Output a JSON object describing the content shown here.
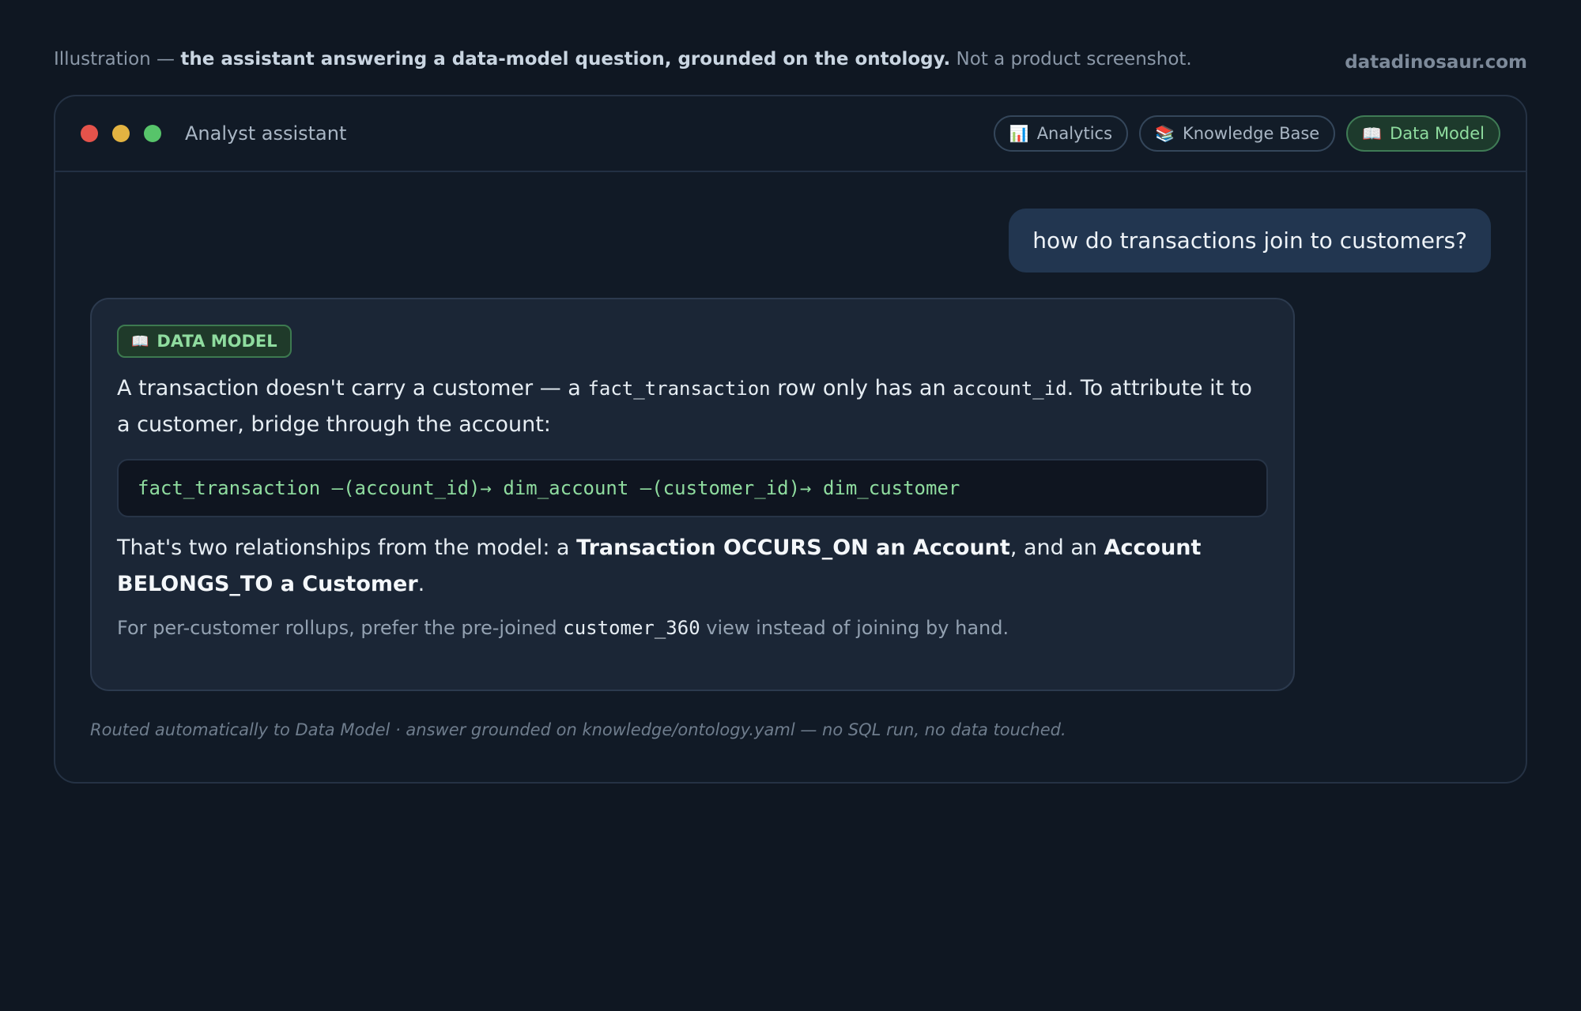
{
  "caption": {
    "prefix": "Illustration — ",
    "bold": "the assistant answering a data-model question, grounded on the ontology.",
    "suffix": " Not a product screenshot."
  },
  "brand": "datadinosaur.com",
  "window": {
    "title": "Analyst assistant",
    "tabs": [
      {
        "label": "Analytics",
        "icon": "bar-chart-icon"
      },
      {
        "label": "Knowledge Base",
        "icon": "books-icon"
      },
      {
        "label": "Data Model",
        "icon": "open-book-icon",
        "active": true
      }
    ]
  },
  "conversation": {
    "user_message": "how do transactions join to customers?",
    "answer": {
      "badge": "DATA MODEL",
      "p1": {
        "t1": "A transaction doesn't carry a customer — a ",
        "c1": "fact_transaction",
        "t2": " row only has an ",
        "c2": "account_id",
        "t3": ". To attribute it to a customer, bridge through the account:"
      },
      "code": "fact_transaction —(account_id)→ dim_account —(customer_id)→ dim_customer",
      "p2": {
        "t1": "That's two relationships from the model: a ",
        "b1": "Transaction OCCURS_ON an Account",
        "t2": ", and an ",
        "b2": "Account BELONGS_TO a Customer",
        "t3": "."
      },
      "note": {
        "t1": "For per-customer rollups, prefer the pre-joined ",
        "c1": "customer_360",
        "t2": " view instead of joining by hand."
      }
    },
    "footer": "Routed automatically to Data Model · answer grounded on knowledge/ontology.yaml — no SQL run, no data touched."
  },
  "colors": {
    "background": "#0f1722",
    "accent_green": "#8fdc9f",
    "user_bubble": "#223650",
    "dot_red": "#e5534b",
    "dot_yellow": "#e3b341",
    "dot_green": "#57c46a"
  }
}
